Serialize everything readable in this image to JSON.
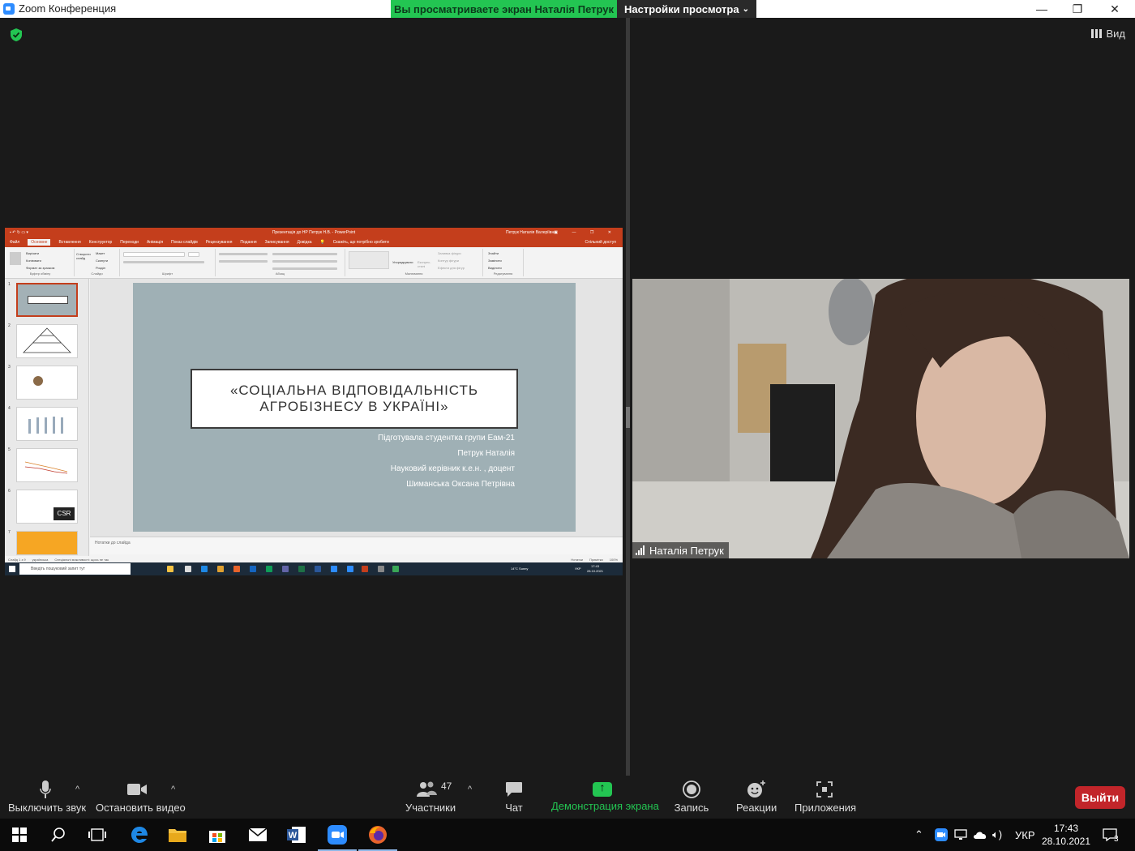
{
  "window": {
    "title": "Zoom Конференция",
    "minimize": "—",
    "restore": "❐",
    "close": "✕"
  },
  "banner": {
    "viewing": "Вы просматриваете экран Наталія Петрук",
    "view_options": "Настройки просмотра"
  },
  "view": {
    "label": "Вид"
  },
  "ppt": {
    "title": "Презентація до НР Петрук Н.В.  -  PowerPoint",
    "user": "Петрук Наталія Валеріївна",
    "tabs": [
      "Файл",
      "Основне",
      "Вставлення",
      "Конструктор",
      "Переходи",
      "Анімація",
      "Показ слайдів",
      "Рецензування",
      "Подання",
      "Записування",
      "Довідка"
    ],
    "tell_me": "Скажіть, що потрібно зробити",
    "share": "Спільний доступ",
    "ribbon_groups": [
      "Буфер обміну",
      "Слайди",
      "Шрифт",
      "Абзац",
      "Малювання",
      "Редагування"
    ],
    "clipboard": [
      "Вирізати",
      "Копіювати",
      "Формат за зразком"
    ],
    "slides_btns": [
      "Макет",
      "Скинути",
      "Розділ"
    ],
    "create_slide": "Створити слайд",
    "arrange": "Упорядкувати",
    "quick_styles": "Експрес-стилі",
    "shape_opts": [
      "Заливка фігури",
      "Контур фігури",
      "Ефекти для фігур"
    ],
    "edit_btns": [
      "Знайти",
      "Замінити",
      "Виділити"
    ],
    "slide": {
      "title": "«СОЦІАЛЬНА ВІДПОВІДАЛЬНІСТЬ АГРОБІЗНЕСУ В УКРАЇНІ»",
      "lines": [
        "Підготувала студентка групи Еам-21",
        "Петрук Наталія",
        "Науковий керівник к.е.н. , доцент",
        "Шиманська Оксана Петрівна"
      ]
    },
    "thumb_numbers": [
      "1",
      "2",
      "3",
      "4",
      "5",
      "6",
      "7"
    ],
    "thumb6_badge": "CSR",
    "notes": "Нотатки до слайда",
    "status": {
      "slide": "Слайд 1 з 9",
      "lang": "українська",
      "accessibility": "Спеціальні можливості: щось не так",
      "notes_btn": "Нотатки",
      "comments_btn": "Примітки",
      "zoom": "100%"
    },
    "taskbar": {
      "search": "Введіть пошуковий запит тут",
      "weather": "14°C  Sunny",
      "lang": "УКР",
      "time": "17:43",
      "date": "28.10.2021"
    }
  },
  "video": {
    "name": "Наталія Петрук"
  },
  "toolbar": {
    "mute": "Выключить звук",
    "stop_video": "Остановить видео",
    "participants": "Участники",
    "participants_count": "47",
    "chat": "Чат",
    "share": "Демонстрация экрана",
    "record": "Запись",
    "reactions": "Реакции",
    "apps": "Приложения",
    "leave": "Выйти"
  },
  "taskbar": {
    "lang": "УКР",
    "time": "17:43",
    "date": "28.10.2021",
    "notif_count": "3"
  },
  "colors": {
    "share_green": "#23c552",
    "leave_red": "#c2252a",
    "ppt_red": "#c43e1c",
    "slide_bg": "#9fb0b5"
  }
}
